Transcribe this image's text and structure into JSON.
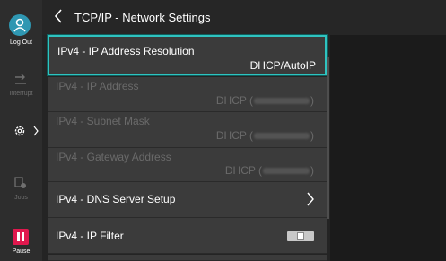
{
  "rail": {
    "logout_label": "Log Out",
    "interrupt_label": "Interrupt",
    "jobs_label": "Jobs",
    "pause_label": "Pause"
  },
  "header": {
    "title": "TCP/IP - Network Settings"
  },
  "list": {
    "rows": [
      {
        "label": "IPv4 - IP Address Resolution",
        "value": "DHCP/AutoIP",
        "state": "selected"
      },
      {
        "label": "IPv4 - IP Address",
        "value_prefix": "DHCP (",
        "value_suffix": ")",
        "state": "disabled"
      },
      {
        "label": "IPv4 - Subnet Mask",
        "value_prefix": "DHCP (",
        "value_suffix": ")",
        "state": "disabled"
      },
      {
        "label": "IPv4 - Gateway Address",
        "value_prefix": "DHCP (",
        "value_suffix": ")",
        "state": "disabled"
      },
      {
        "label": "IPv4 - DNS Server Setup",
        "state": "enabled"
      },
      {
        "label": "IPv4 - IP Filter",
        "state": "enabled"
      }
    ]
  },
  "colors": {
    "accent": "#2fc3c0",
    "logout": "#2f97b2",
    "pause": "#e0184e"
  },
  "icons": {
    "logout": "person-logout-icon",
    "interrupt": "interrupt-icon",
    "settings": "gear-icon",
    "jobs": "jobs-icon",
    "pause": "pause-icon",
    "back": "chevron-left-icon",
    "next": "chevron-right-icon"
  }
}
